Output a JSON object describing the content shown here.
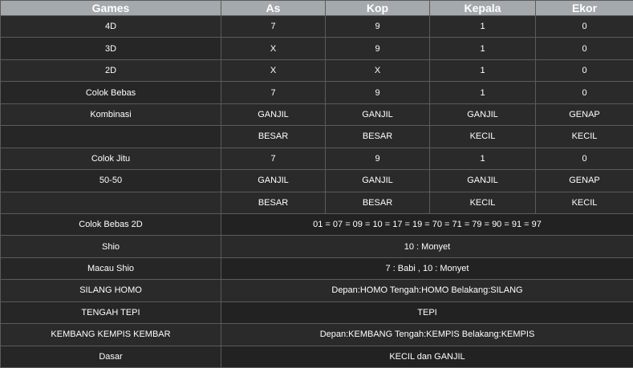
{
  "headers": [
    "Games",
    "As",
    "Kop",
    "Kepala",
    "Ekor"
  ],
  "rows": [
    {
      "label": "4D",
      "values": [
        "7",
        "9",
        "1",
        "0"
      ]
    },
    {
      "label": "3D",
      "values": [
        "X",
        "9",
        "1",
        "0"
      ]
    },
    {
      "label": "2D",
      "values": [
        "X",
        "X",
        "1",
        "0"
      ]
    },
    {
      "label": "Colok Bebas",
      "values": [
        "7",
        "9",
        "1",
        "0"
      ]
    },
    {
      "label": "Kombinasi",
      "values": [
        "GANJIL",
        "GANJIL",
        "GANJIL",
        "GENAP"
      ]
    },
    {
      "label": "",
      "values": [
        "BESAR",
        "BESAR",
        "KECIL",
        "KECIL"
      ]
    },
    {
      "label": "Colok Jitu",
      "values": [
        "7",
        "9",
        "1",
        "0"
      ]
    },
    {
      "label": "50-50",
      "values": [
        "GANJIL",
        "GANJIL",
        "GANJIL",
        "GENAP"
      ]
    },
    {
      "label": "",
      "values": [
        "BESAR",
        "BESAR",
        "KECIL",
        "KECIL"
      ]
    }
  ],
  "span_rows": [
    {
      "label": "Colok Bebas 2D",
      "value": "01 = 07 = 09 = 10 = 17 = 19 = 70 = 71 = 79 = 90 = 91 = 97"
    },
    {
      "label": "Shio",
      "value": "10 : Monyet"
    },
    {
      "label": "Macau Shio",
      "value": "7 : Babi , 10 : Monyet"
    },
    {
      "label": "SILANG HOMO",
      "value": "Depan:HOMO Tengah:HOMO Belakang:SILANG"
    },
    {
      "label": "TENGAH TEPI",
      "value": "TEPI"
    },
    {
      "label": "KEMBANG KEMPIS KEMBAR",
      "value": "Depan:KEMBANG Tengah:KEMPIS Belakang:KEMPIS"
    },
    {
      "label": "Dasar",
      "value": "KECIL dan GANJIL"
    }
  ]
}
